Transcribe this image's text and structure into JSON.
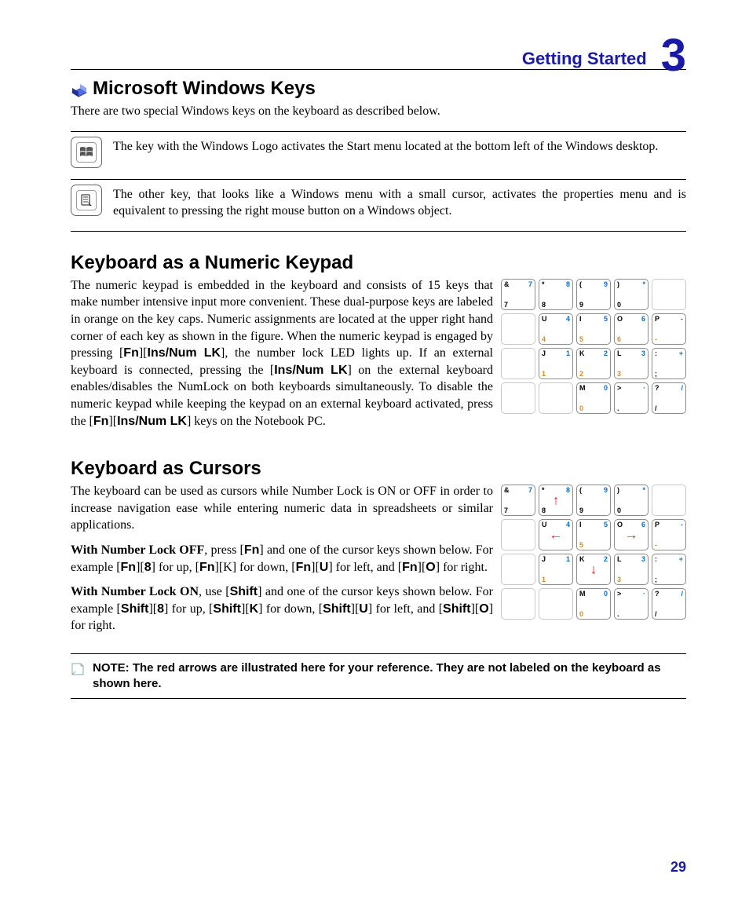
{
  "header": {
    "chapter_title": "Getting Started",
    "chapter_num": "3"
  },
  "sec_winkeys": {
    "title": "Microsoft Windows Keys",
    "intro": "There are two special Windows keys on the keyboard as described below.",
    "row1": "The key with the Windows Logo activates the Start menu located at the bottom left of the Windows desktop.",
    "row2": "The other key, that looks like a Windows menu with a small cursor, activates the properties menu and is equivalent to pressing the right mouse button on a Windows object."
  },
  "sec_numpad": {
    "title": "Keyboard as a Numeric Keypad",
    "para_a": "The numeric keypad is embedded in the keyboard and consists of 15 keys that make number intensive input more convenient. These dual-purpose keys are labeled in orange on the key caps. Numeric assignments are located at the upper right hand corner of each key as shown in the figure. When the numeric keypad is engaged by pressing [",
    "k1": "Fn",
    "para_b": "][",
    "k2": "Ins/Num LK",
    "para_c": "], the number lock LED lights up. If an external keyboard is connected, pressing the [",
    "k3": "Ins/Num LK",
    "para_d": "] on the external keyboard enables/disables the NumLock on both keyboards simultaneously. To disable the numeric keypad while keeping the keypad on an external keyboard activated, press the  [",
    "k4": "Fn",
    "para_e": "][",
    "k5": "Ins/Num LK",
    "para_f": "] keys on the Notebook PC."
  },
  "sec_cursors": {
    "title": "Keyboard as Cursors",
    "p1": "The keyboard can be used as cursors while Number Lock is ON or OFF in order to increase navigation ease while entering numeric data in spreadsheets or similar applications.",
    "p2_lead": "With Number Lock OFF",
    "p2_a": ", press [",
    "p2_fn1": "Fn",
    "p2_b": "] and one of the cursor keys shown below. For example [",
    "p2_fn2": "Fn",
    "p2_c": "][",
    "p2_8": "8",
    "p2_d": "] for up, [",
    "p2_fn3": "Fn",
    "p2_e": "][K] for down, [",
    "p2_fn4": "Fn",
    "p2_f": "][",
    "p2_U": "U",
    "p2_g": "] for left, and [",
    "p2_fn5": "Fn",
    "p2_h": "][",
    "p2_O": "O",
    "p2_i": "] for right.",
    "p3_lead": "With Number Lock ON",
    "p3_a": ", use [",
    "p3_s1": "Shift",
    "p3_b": "] and one of the cursor keys shown below. For example [",
    "p3_s2": "Shift",
    "p3_c": "][",
    "p3_8": "8",
    "p3_d": "] for up, [",
    "p3_s3": "Shift",
    "p3_e": "][",
    "p3_K": "K",
    "p3_f": "] for down, [",
    "p3_s4": "Shift",
    "p3_g": "][",
    "p3_U": "U",
    "p3_h": "] for left, and [",
    "p3_s5": "Shift",
    "p3_i": "][",
    "p3_O": "O",
    "p3_j": "] for right."
  },
  "note": {
    "lead": "NOTE: ",
    "text": "The red arrows are illustrated here for your reference. They are not labeled on the keyboard as shown here."
  },
  "page_number": "29",
  "keypad": {
    "rows": [
      [
        {
          "tl": "&",
          "tr": "7",
          "bl": "7"
        },
        {
          "tl": "*",
          "tr": "8",
          "bl": "8"
        },
        {
          "tl": "(",
          "tr": "9",
          "bl": "9"
        },
        {
          "tl": ")",
          "tr": "*",
          "bl": "0"
        },
        {
          "blank": true
        }
      ],
      [
        {
          "blank": true
        },
        {
          "tl": "U",
          "tr": "4",
          "bo": "4"
        },
        {
          "tl": "I",
          "tr": "5",
          "bo": "5"
        },
        {
          "tl": "O",
          "tr": "6",
          "bo": "6"
        },
        {
          "tl": "P",
          "tr": "-",
          "bo": "-"
        }
      ],
      [
        {
          "blank": true
        },
        {
          "tl": "J",
          "tr": "1",
          "bo": "1"
        },
        {
          "tl": "K",
          "tr": "2",
          "bo": "2"
        },
        {
          "tl": "L",
          "tr": "3",
          "bo": "3"
        },
        {
          "tl": ":",
          "tr": "+",
          "bl": ";"
        }
      ],
      [
        {
          "blank": true
        },
        {
          "blank": true
        },
        {
          "tl": "M",
          "tr": "0",
          "bo": "0"
        },
        {
          "tl": ">",
          "tr": "·",
          "bl": "."
        },
        {
          "tl": "?",
          "tr": "/",
          "bl": "/"
        }
      ]
    ]
  },
  "keypad_arrows": {
    "rows": [
      [
        {
          "tl": "&",
          "tr": "7",
          "bl": "7"
        },
        {
          "tl": "*",
          "tr": "8",
          "bl": "8",
          "arrow": "↑"
        },
        {
          "tl": "(",
          "tr": "9",
          "bl": "9"
        },
        {
          "tl": ")",
          "tr": "*",
          "bl": "0"
        },
        {
          "blank": true
        }
      ],
      [
        {
          "blank": true
        },
        {
          "tl": "U",
          "tr": "4",
          "arrow": "←"
        },
        {
          "tl": "I",
          "tr": "5",
          "bo": "5"
        },
        {
          "tl": "O",
          "tr": "6",
          "arrow": "→"
        },
        {
          "tl": "P",
          "tr": "-",
          "bo": "-"
        }
      ],
      [
        {
          "blank": true
        },
        {
          "tl": "J",
          "tr": "1",
          "bo": "1"
        },
        {
          "tl": "K",
          "tr": "2",
          "arrow": "↓"
        },
        {
          "tl": "L",
          "tr": "3",
          "bo": "3"
        },
        {
          "tl": ":",
          "tr": "+",
          "bl": ";"
        }
      ],
      [
        {
          "blank": true
        },
        {
          "blank": true
        },
        {
          "tl": "M",
          "tr": "0",
          "bo": "0"
        },
        {
          "tl": ">",
          "tr": "·",
          "bl": "."
        },
        {
          "tl": "?",
          "tr": "/",
          "bl": "/"
        }
      ]
    ]
  }
}
